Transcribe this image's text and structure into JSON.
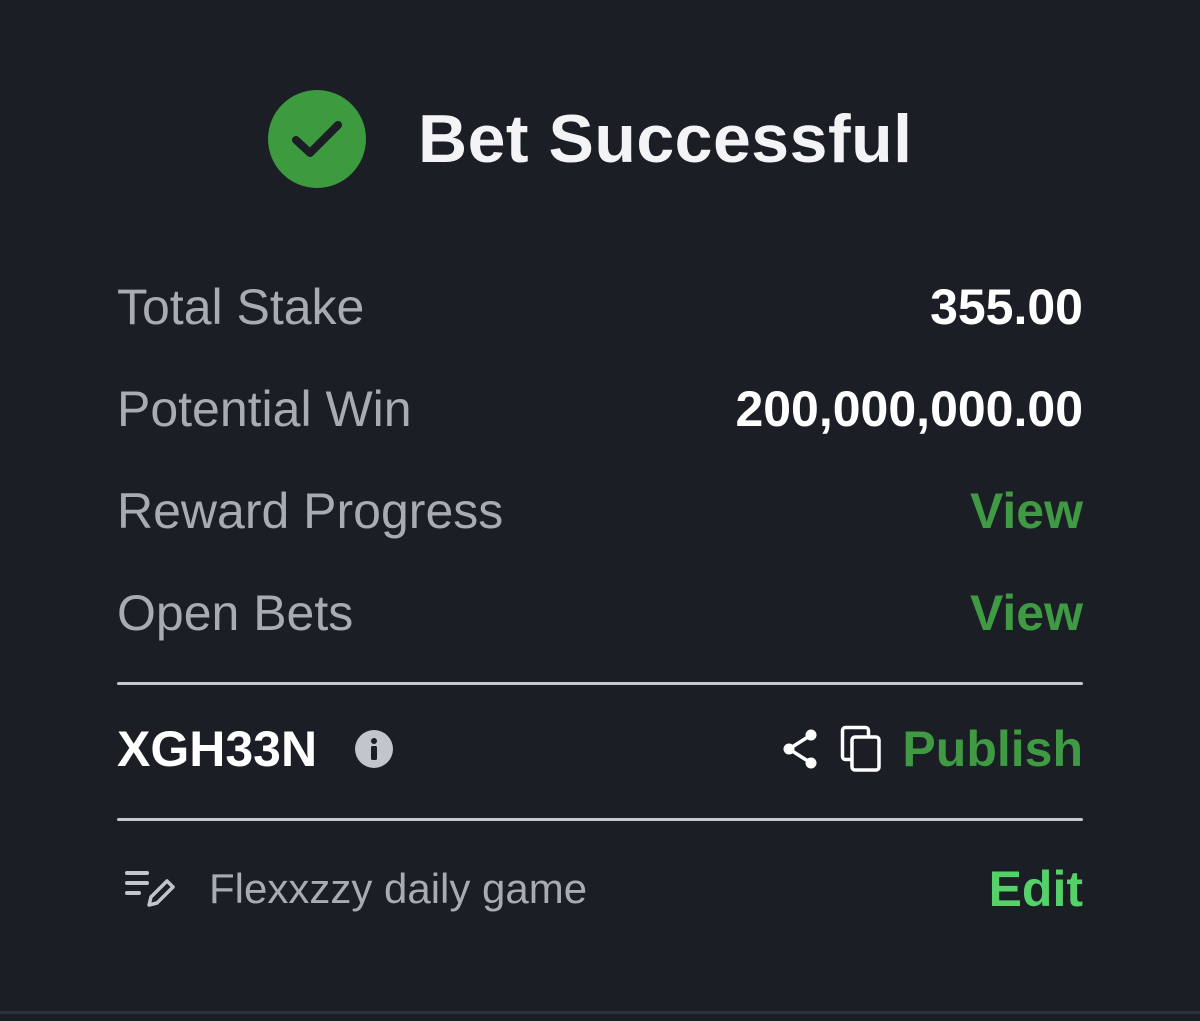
{
  "header": {
    "title": "Bet Successful",
    "icon": "check-circle-icon",
    "accent_color": "#3d9a3f"
  },
  "summary": {
    "total_stake_label": "Total Stake",
    "total_stake_value": "355.00",
    "potential_win_label": "Potential Win",
    "potential_win_value": "200,000,000.00",
    "reward_progress_label": "Reward Progress",
    "reward_progress_link": "View",
    "open_bets_label": "Open Bets",
    "open_bets_link": "View"
  },
  "booking": {
    "code": "XGH33N",
    "info_icon": "info-icon",
    "share_icon": "share-icon",
    "copy_icon": "copy-icon",
    "publish_label": "Publish"
  },
  "note": {
    "icon": "edit-list-icon",
    "text": "Flexxzzy daily game",
    "edit_label": "Edit"
  },
  "colors": {
    "background": "#1b1e25",
    "link_green": "#3f9a43",
    "edit_green": "#55d16a",
    "muted_text": "#a9abb3"
  }
}
